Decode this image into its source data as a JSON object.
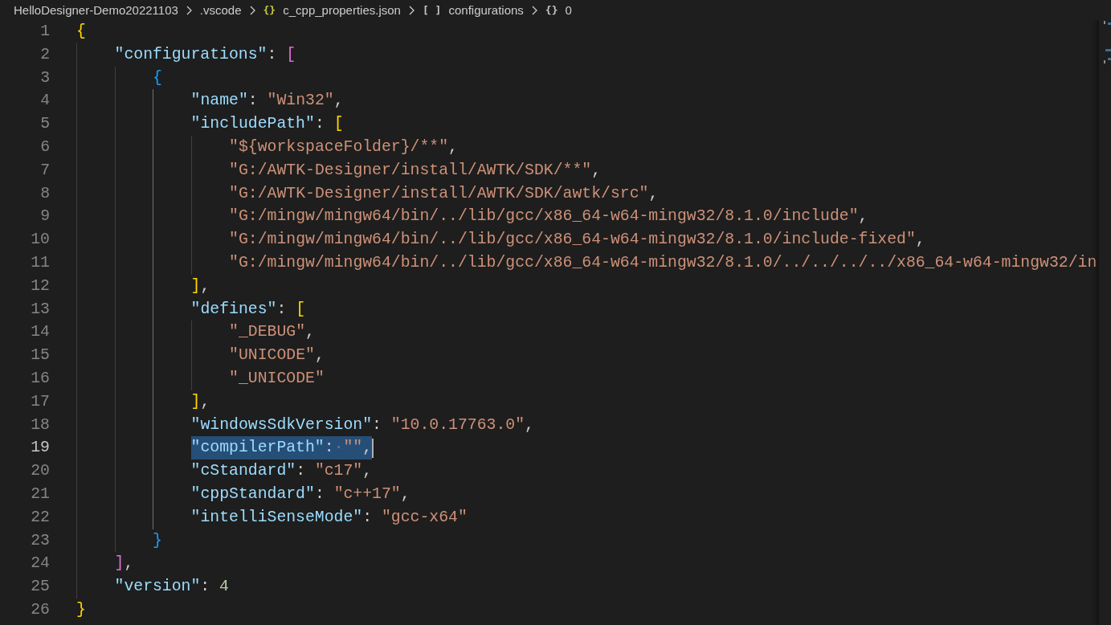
{
  "breadcrumbs": [
    {
      "kind": "folder",
      "label": "HelloDesigner-Demo20221103"
    },
    {
      "kind": "folder",
      "label": ".vscode"
    },
    {
      "kind": "file",
      "icon": "{}",
      "label": "c_cpp_properties.json"
    },
    {
      "kind": "array",
      "icon": "[ ]",
      "label": "configurations"
    },
    {
      "kind": "object",
      "icon": "{}",
      "label": "0"
    }
  ],
  "editor": {
    "lines": [
      {
        "number": "1",
        "selected": false,
        "tokens": [
          {
            "kind": "bracket",
            "text": "{",
            "color": "#ffd700"
          }
        ],
        "children": [
          {
            "number": "2",
            "selected": false,
            "tokens": [
              {
                "kind": "key",
                "text": "\"configurations\""
              },
              {
                "kind": "punct",
                "text": ": "
              },
              {
                "kind": "bracket",
                "text": "[",
                "color": "#da70d6"
              }
            ],
            "children": [
              {
                "number": "3",
                "selected": false,
                "tokens": [
                  {
                    "kind": "bracket",
                    "text": "{",
                    "color": "#179fff"
                  }
                ],
                "children": [
                  {
                    "number": "4",
                    "selected": false,
                    "tokens": [
                      {
                        "kind": "key",
                        "text": "\"name\""
                      },
                      {
                        "kind": "punct",
                        "text": ": "
                      },
                      {
                        "kind": "string",
                        "text": "\"Win32\""
                      },
                      {
                        "kind": "punct",
                        "text": ","
                      }
                    ]
                  },
                  {
                    "number": "5",
                    "selected": false,
                    "tokens": [
                      {
                        "kind": "key",
                        "text": "\"includePath\""
                      },
                      {
                        "kind": "punct",
                        "text": ": "
                      },
                      {
                        "kind": "bracket",
                        "text": "[",
                        "color": "#ffd700"
                      }
                    ],
                    "children": [
                      {
                        "number": "6",
                        "selected": false,
                        "tokens": [
                          {
                            "kind": "string",
                            "text": "\"${workspaceFolder}/**\""
                          },
                          {
                            "kind": "punct",
                            "text": ","
                          }
                        ]
                      },
                      {
                        "number": "7",
                        "selected": false,
                        "tokens": [
                          {
                            "kind": "string",
                            "text": "\"G:/AWTK-Designer/install/AWTK/SDK/**\""
                          },
                          {
                            "kind": "punct",
                            "text": ","
                          }
                        ]
                      },
                      {
                        "number": "8",
                        "selected": false,
                        "tokens": [
                          {
                            "kind": "string",
                            "text": "\"G:/AWTK-Designer/install/AWTK/SDK/awtk/src\""
                          },
                          {
                            "kind": "punct",
                            "text": ","
                          }
                        ]
                      },
                      {
                        "number": "9",
                        "selected": false,
                        "tokens": [
                          {
                            "kind": "string",
                            "text": "\"G:/mingw/mingw64/bin/../lib/gcc/x86_64-w64-mingw32/8.1.0/include\""
                          },
                          {
                            "kind": "punct",
                            "text": ","
                          }
                        ]
                      },
                      {
                        "number": "10",
                        "selected": false,
                        "tokens": [
                          {
                            "kind": "string",
                            "text": "\"G:/mingw/mingw64/bin/../lib/gcc/x86_64-w64-mingw32/8.1.0/include-fixed\""
                          },
                          {
                            "kind": "punct",
                            "text": ","
                          }
                        ]
                      },
                      {
                        "number": "11",
                        "selected": false,
                        "tokens": [
                          {
                            "kind": "string",
                            "text": "\"G:/mingw/mingw64/bin/../lib/gcc/x86_64-w64-mingw32/8.1.0/../../../../x86_64-w64-mingw32/in"
                          }
                        ]
                      }
                    ]
                  },
                  {
                    "number": "12",
                    "selected": false,
                    "tokens": [
                      {
                        "kind": "bracket",
                        "text": "]",
                        "color": "#ffd700"
                      },
                      {
                        "kind": "punct",
                        "text": ","
                      }
                    ]
                  },
                  {
                    "number": "13",
                    "selected": false,
                    "tokens": [
                      {
                        "kind": "key",
                        "text": "\"defines\""
                      },
                      {
                        "kind": "punct",
                        "text": ": "
                      },
                      {
                        "kind": "bracket",
                        "text": "[",
                        "color": "#ffd700"
                      }
                    ],
                    "children": [
                      {
                        "number": "14",
                        "selected": false,
                        "tokens": [
                          {
                            "kind": "string",
                            "text": "\"_DEBUG\""
                          },
                          {
                            "kind": "punct",
                            "text": ","
                          }
                        ]
                      },
                      {
                        "number": "15",
                        "selected": false,
                        "tokens": [
                          {
                            "kind": "string",
                            "text": "\"UNICODE\""
                          },
                          {
                            "kind": "punct",
                            "text": ","
                          }
                        ]
                      },
                      {
                        "number": "16",
                        "selected": false,
                        "tokens": [
                          {
                            "kind": "string",
                            "text": "\"_UNICODE\""
                          }
                        ]
                      }
                    ]
                  },
                  {
                    "number": "17",
                    "selected": false,
                    "tokens": [
                      {
                        "kind": "bracket",
                        "text": "]",
                        "color": "#ffd700"
                      },
                      {
                        "kind": "punct",
                        "text": ","
                      }
                    ]
                  },
                  {
                    "number": "18",
                    "selected": false,
                    "tokens": [
                      {
                        "kind": "key",
                        "text": "\"windowsSdkVersion\""
                      },
                      {
                        "kind": "punct",
                        "text": ": "
                      },
                      {
                        "kind": "string",
                        "text": "\"10.0.17763.0\""
                      },
                      {
                        "kind": "punct",
                        "text": ","
                      }
                    ]
                  },
                  {
                    "number": "19",
                    "selected": true,
                    "tokens": [
                      {
                        "kind": "key",
                        "text": "\"compilerPath\""
                      },
                      {
                        "kind": "punct",
                        "text": ":"
                      },
                      {
                        "kind": "whitespace",
                        "text": "·"
                      },
                      {
                        "kind": "string",
                        "text": "\"\""
                      },
                      {
                        "kind": "punct",
                        "text": ","
                      }
                    ]
                  },
                  {
                    "number": "20",
                    "selected": false,
                    "tokens": [
                      {
                        "kind": "key",
                        "text": "\"cStandard\""
                      },
                      {
                        "kind": "punct",
                        "text": ": "
                      },
                      {
                        "kind": "string",
                        "text": "\"c17\""
                      },
                      {
                        "kind": "punct",
                        "text": ","
                      }
                    ]
                  },
                  {
                    "number": "21",
                    "selected": false,
                    "tokens": [
                      {
                        "kind": "key",
                        "text": "\"cppStandard\""
                      },
                      {
                        "kind": "punct",
                        "text": ": "
                      },
                      {
                        "kind": "string",
                        "text": "\"c++17\""
                      },
                      {
                        "kind": "punct",
                        "text": ","
                      }
                    ]
                  },
                  {
                    "number": "22",
                    "selected": false,
                    "tokens": [
                      {
                        "kind": "key",
                        "text": "\"intelliSenseMode\""
                      },
                      {
                        "kind": "punct",
                        "text": ": "
                      },
                      {
                        "kind": "string",
                        "text": "\"gcc-x64\""
                      }
                    ]
                  }
                ]
              },
              {
                "number": "23",
                "selected": false,
                "tokens": [
                  {
                    "kind": "bracket",
                    "text": "}",
                    "color": "#179fff"
                  }
                ]
              }
            ]
          },
          {
            "number": "24",
            "selected": false,
            "tokens": [
              {
                "kind": "bracket",
                "text": "]",
                "color": "#da70d6"
              },
              {
                "kind": "punct",
                "text": ","
              }
            ]
          },
          {
            "number": "25",
            "selected": false,
            "tokens": [
              {
                "kind": "key",
                "text": "\"version\""
              },
              {
                "kind": "punct",
                "text": ": "
              },
              {
                "kind": "number",
                "text": "4"
              }
            ]
          }
        ]
      },
      {
        "number": "26",
        "selected": false,
        "tokens": [
          {
            "kind": "bracket",
            "text": "}",
            "color": "#ffd700"
          }
        ]
      }
    ]
  }
}
